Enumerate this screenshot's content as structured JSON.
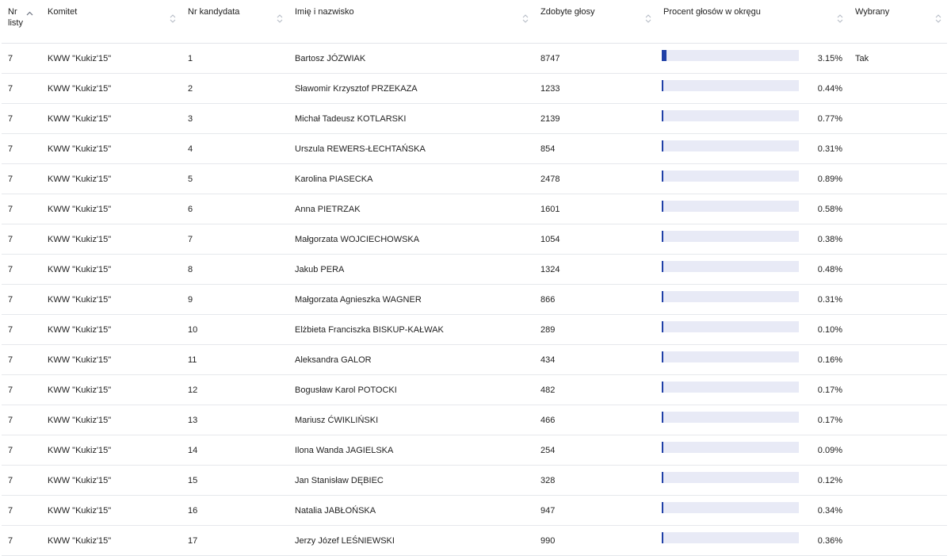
{
  "columns": [
    {
      "key": "list",
      "label": "Nr listy"
    },
    {
      "key": "committee",
      "label": "Komitet"
    },
    {
      "key": "candidate_no",
      "label": "Nr kandydata"
    },
    {
      "key": "name",
      "label": "Imię i nazwisko"
    },
    {
      "key": "votes",
      "label": "Zdobyte głosy"
    },
    {
      "key": "percent",
      "label": "Procent głosów w okręgu"
    },
    {
      "key": "elected",
      "label": "Wybrany"
    }
  ],
  "colors": {
    "bar_fill": "#1f3fa7",
    "bar_track": "#e8eaf6"
  },
  "rows": [
    {
      "list": "7",
      "committee": "KWW \"Kukiz'15\"",
      "candidate_no": "1",
      "name": "Bartosz JÓZWIAK",
      "votes": "8747",
      "percent": "3.15%",
      "percent_value": 3.15,
      "elected": "Tak"
    },
    {
      "list": "7",
      "committee": "KWW \"Kukiz'15\"",
      "candidate_no": "2",
      "name": "Sławomir Krzysztof PRZEKAZA",
      "votes": "1233",
      "percent": "0.44%",
      "percent_value": 0.44,
      "elected": ""
    },
    {
      "list": "7",
      "committee": "KWW \"Kukiz'15\"",
      "candidate_no": "3",
      "name": "Michał Tadeusz KOTLARSKI",
      "votes": "2139",
      "percent": "0.77%",
      "percent_value": 0.77,
      "elected": ""
    },
    {
      "list": "7",
      "committee": "KWW \"Kukiz'15\"",
      "candidate_no": "4",
      "name": "Urszula REWERS-ŁECHTAŃSKA",
      "votes": "854",
      "percent": "0.31%",
      "percent_value": 0.31,
      "elected": ""
    },
    {
      "list": "7",
      "committee": "KWW \"Kukiz'15\"",
      "candidate_no": "5",
      "name": "Karolina PIASECKA",
      "votes": "2478",
      "percent": "0.89%",
      "percent_value": 0.89,
      "elected": ""
    },
    {
      "list": "7",
      "committee": "KWW \"Kukiz'15\"",
      "candidate_no": "6",
      "name": "Anna PIETRZAK",
      "votes": "1601",
      "percent": "0.58%",
      "percent_value": 0.58,
      "elected": ""
    },
    {
      "list": "7",
      "committee": "KWW \"Kukiz'15\"",
      "candidate_no": "7",
      "name": "Małgorzata WOJCIECHOWSKA",
      "votes": "1054",
      "percent": "0.38%",
      "percent_value": 0.38,
      "elected": ""
    },
    {
      "list": "7",
      "committee": "KWW \"Kukiz'15\"",
      "candidate_no": "8",
      "name": "Jakub PERA",
      "votes": "1324",
      "percent": "0.48%",
      "percent_value": 0.48,
      "elected": ""
    },
    {
      "list": "7",
      "committee": "KWW \"Kukiz'15\"",
      "candidate_no": "9",
      "name": "Małgorzata Agnieszka WAGNER",
      "votes": "866",
      "percent": "0.31%",
      "percent_value": 0.31,
      "elected": ""
    },
    {
      "list": "7",
      "committee": "KWW \"Kukiz'15\"",
      "candidate_no": "10",
      "name": "Elżbieta Franciszka BISKUP-KAŁWAK",
      "votes": "289",
      "percent": "0.10%",
      "percent_value": 0.1,
      "elected": ""
    },
    {
      "list": "7",
      "committee": "KWW \"Kukiz'15\"",
      "candidate_no": "11",
      "name": "Aleksandra GALOR",
      "votes": "434",
      "percent": "0.16%",
      "percent_value": 0.16,
      "elected": ""
    },
    {
      "list": "7",
      "committee": "KWW \"Kukiz'15\"",
      "candidate_no": "12",
      "name": "Bogusław Karol POTOCKI",
      "votes": "482",
      "percent": "0.17%",
      "percent_value": 0.17,
      "elected": ""
    },
    {
      "list": "7",
      "committee": "KWW \"Kukiz'15\"",
      "candidate_no": "13",
      "name": "Mariusz ĆWIKLIŃSKI",
      "votes": "466",
      "percent": "0.17%",
      "percent_value": 0.17,
      "elected": ""
    },
    {
      "list": "7",
      "committee": "KWW \"Kukiz'15\"",
      "candidate_no": "14",
      "name": "Ilona Wanda JAGIELSKA",
      "votes": "254",
      "percent": "0.09%",
      "percent_value": 0.09,
      "elected": ""
    },
    {
      "list": "7",
      "committee": "KWW \"Kukiz'15\"",
      "candidate_no": "15",
      "name": "Jan Stanisław DĘBIEC",
      "votes": "328",
      "percent": "0.12%",
      "percent_value": 0.12,
      "elected": ""
    },
    {
      "list": "7",
      "committee": "KWW \"Kukiz'15\"",
      "candidate_no": "16",
      "name": "Natalia JABŁOŃSKA",
      "votes": "947",
      "percent": "0.34%",
      "percent_value": 0.34,
      "elected": ""
    },
    {
      "list": "7",
      "committee": "KWW \"Kukiz'15\"",
      "candidate_no": "17",
      "name": "Jerzy Józef LEŚNIEWSKI",
      "votes": "990",
      "percent": "0.36%",
      "percent_value": 0.36,
      "elected": ""
    }
  ]
}
